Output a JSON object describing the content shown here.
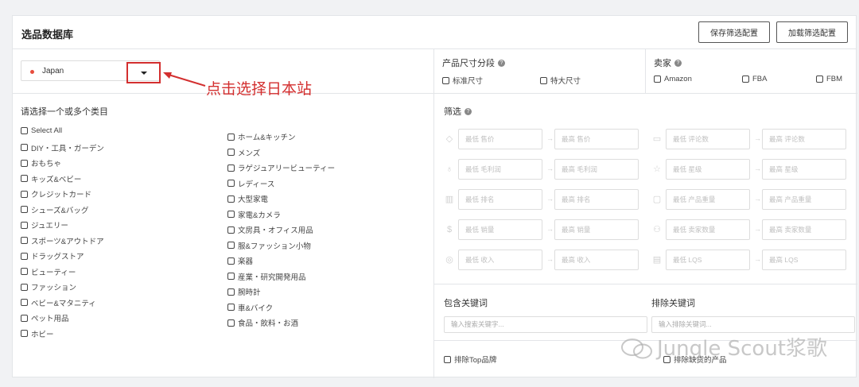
{
  "header": {
    "title": "选品数据库",
    "save_filter": "保存筛选配置",
    "load_filter": "加载筛选配置"
  },
  "market": {
    "selected": "Japan"
  },
  "annotation": "点击选择日本站",
  "categories": {
    "label": "请选择一个或多个类目",
    "left": [
      "Select All",
      "DIY・工具・ガーデン",
      "おもちゃ",
      "キッズ&ベビー",
      "クレジットカード",
      "シューズ&バッグ",
      "ジュエリー",
      "スポーツ&アウトドア",
      "ドラッグストア",
      "ビューティー",
      "ファッション",
      "ベビー&マタニティ",
      "ペット用品",
      "ホビー"
    ],
    "right": [
      "ホーム&キッチン",
      "メンズ",
      "ラゲジュアリービューティー",
      "レディース",
      "大型家電",
      "家電&カメラ",
      "文房具・オフィス用品",
      "服&ファッション小物",
      "楽器",
      "産業・研究開発用品",
      "腕時計",
      "車&バイク",
      "食品・飲料・お酒"
    ]
  },
  "size_tier": {
    "title": "产品尺寸分段",
    "options": [
      "标准尺寸",
      "特大尺寸"
    ]
  },
  "seller": {
    "title": "卖家",
    "options": [
      "Amazon",
      "FBA",
      "FBM"
    ]
  },
  "filters": {
    "title": "筛选",
    "rows": [
      {
        "icon": "tag-icon",
        "min": "最低 售价",
        "max": "最高 售价",
        "icon2": "comment-icon",
        "min2": "最低 评论数",
        "max2": "最高 评论数"
      },
      {
        "icon": "moneybag-icon",
        "min": "最低 毛利润",
        "max": "最高 毛利润",
        "icon2": "star-icon",
        "min2": "最低 星级",
        "max2": "最高 星级"
      },
      {
        "icon": "bar-chart-icon",
        "min": "最低 排名",
        "max": "最高 排名",
        "icon2": "weight-icon",
        "min2": "最低 产品重量",
        "max2": "最高 产品重量"
      },
      {
        "icon": "dollar-icon",
        "min": "最低 销量",
        "max": "最高 销量",
        "icon2": "sellers-icon",
        "min2": "最低 卖家数量",
        "max2": "最高 卖家数量"
      },
      {
        "icon": "revenue-icon",
        "min": "最低 收入",
        "max": "最高 收入",
        "icon2": "lqs-icon",
        "min2": "最低 LQS",
        "max2": "最高 LQS"
      }
    ]
  },
  "keywords": {
    "include_title": "包含关键词",
    "include_placeholder": "输入搜索关键字...",
    "exclude_title": "排除关键词",
    "exclude_placeholder": "输入排除关键词..."
  },
  "bottom": {
    "exclude_top_brands": "排除Top品牌",
    "exclude_unavailable": "排除缺货的产品"
  },
  "watermark": "Jungle Scout浆歌"
}
